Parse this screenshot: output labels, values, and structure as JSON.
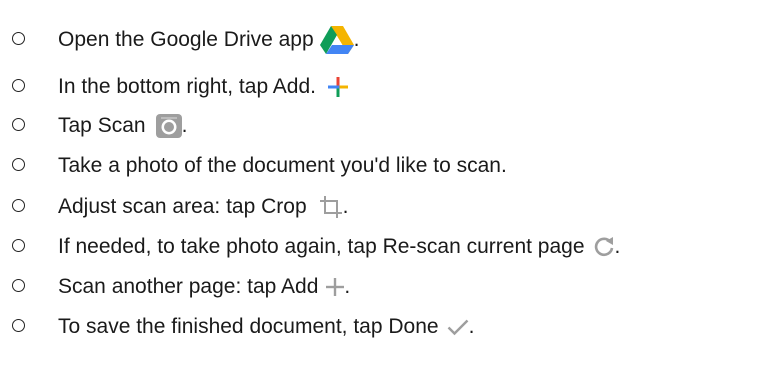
{
  "steps": [
    {
      "text": "Open the Google Drive app",
      "icon": "google-drive-icon",
      "end": "."
    },
    {
      "text": "In the bottom right, tap Add.",
      "icon": "add-colorful-icon",
      "end": ""
    },
    {
      "text": "Tap Scan",
      "icon": "camera-icon",
      "end": "."
    },
    {
      "text": "Take a photo of the document you'd like to scan.",
      "icon": "",
      "end": ""
    },
    {
      "text": "Adjust scan area: tap Crop",
      "icon": "crop-icon",
      "end": "."
    },
    {
      "text": "If needed, to take photo again, tap Re-scan current page",
      "icon": "refresh-icon",
      "end": "."
    },
    {
      "text": "Scan another page: tap Add",
      "icon": "add-icon",
      "end": "."
    },
    {
      "text": "To save the finished document, tap Done",
      "icon": "check-icon",
      "end": "."
    }
  ],
  "colors": {
    "text": "#1a1a1a",
    "drive_green": "#0F9D58",
    "drive_yellow": "#F4B400",
    "drive_blue": "#4285F4",
    "add_red": "#EA4335",
    "icon_gray": "#9e9e9e"
  }
}
